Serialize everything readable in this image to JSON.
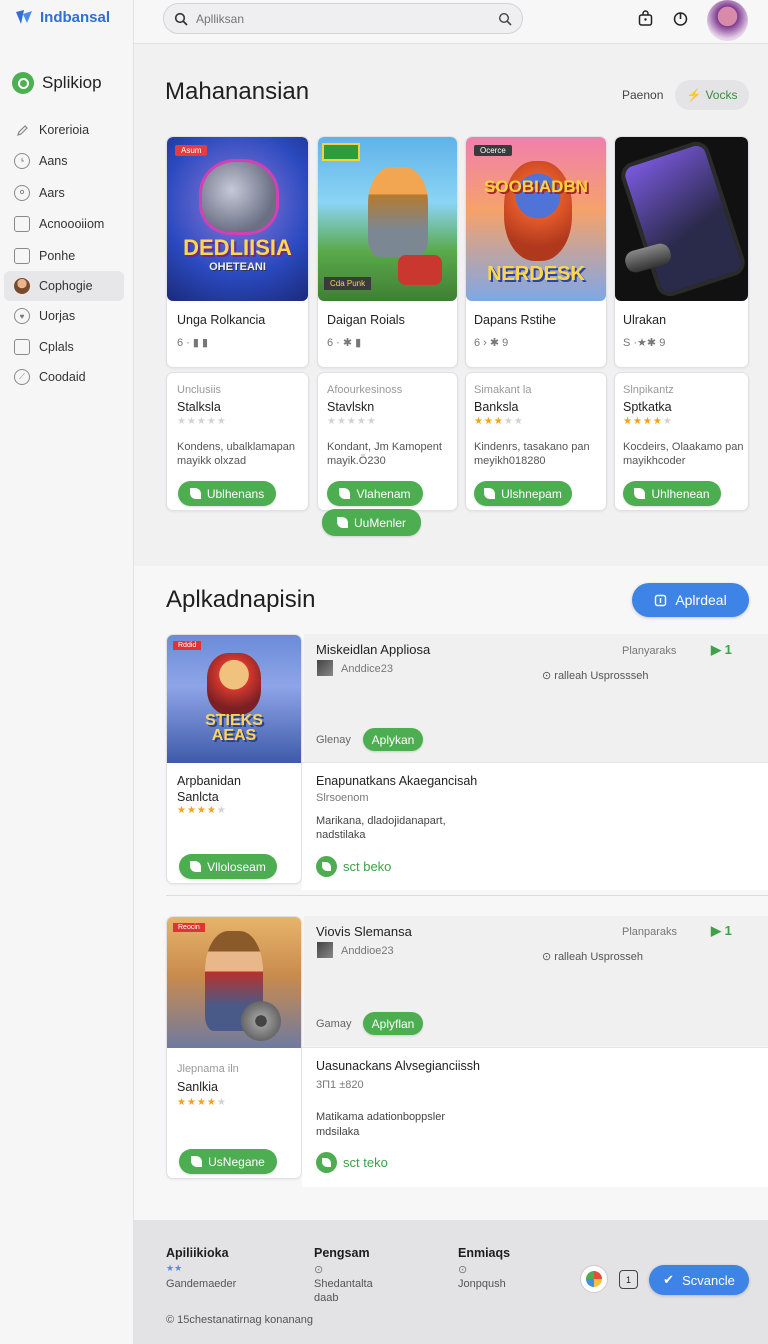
{
  "app": {
    "name": "Indbansal"
  },
  "sidebar": {
    "brand": "Splikiop",
    "items": [
      {
        "label": "Korerioia",
        "icon": "pencil-icon"
      },
      {
        "label": "Aans",
        "icon": "clock-icon"
      },
      {
        "label": "Aars",
        "icon": "user-icon"
      },
      {
        "label": "Acnoooiiom",
        "icon": "document-icon"
      },
      {
        "label": "Ponhe",
        "icon": "file-icon"
      },
      {
        "label": "Cophogie",
        "icon": "avatar-icon",
        "active": true
      },
      {
        "label": "Uorjas",
        "icon": "heart-icon"
      },
      {
        "label": "Cplals",
        "icon": "clipboard-icon"
      },
      {
        "label": "Coodaid",
        "icon": "compass-icon"
      }
    ]
  },
  "search": {
    "placeholder": "Aplliksan"
  },
  "featured": {
    "title": "Mahanansian",
    "filter_label": "Paenon",
    "filter_button": "Vocks",
    "top_cards": [
      {
        "name": "Unga Rolkancia",
        "meta": "6 · ▮ ▮",
        "badge": "Asum",
        "art": "DEDLIISIA",
        "art_sub": "OHETEANI"
      },
      {
        "name": "Daigan Roials",
        "meta": "6 · ✱ ▮",
        "badge": "",
        "art": "",
        "art_sub": "Cda Punk"
      },
      {
        "name": "Dapans Rstihe",
        "meta": "6 › ✱ 9",
        "badge": "Ocerce",
        "art": "SOOBIADBN",
        "art_sub": "NERDESK"
      },
      {
        "name": "Ulrakan",
        "meta": "S ·★✱ 9",
        "badge": "",
        "art": "",
        "art_sub": ""
      }
    ],
    "bottom_cards": [
      {
        "sub": "Unclusiis",
        "name": "Stalksla",
        "rating": 0,
        "desc1": "Kondens, ubalklamapan",
        "desc2": "mayikk olxzad",
        "button": "Ublhenans"
      },
      {
        "sub": "Afoourkesinoss",
        "name": "Stavlskn",
        "rating": 0,
        "desc1": "Kondant, Jm Kamopent",
        "desc2": "mayik.Ö230",
        "button": "Vlahenam"
      },
      {
        "sub": "Simakant la",
        "name": "Banksla",
        "rating": 3,
        "desc1": "Kindenrs, tasakano pan",
        "desc2": "meyikh018280",
        "button": "Ulshnepam"
      },
      {
        "sub": "Slnpikantz",
        "name": "Sptkatka",
        "rating": 4,
        "desc1": "Kocdeirs, Olaakamo pan",
        "desc2": "mayikhcoder",
        "button": "Uhlhenean"
      }
    ],
    "extra_button": "UuMenler"
  },
  "apps": {
    "title": "Aplkadnapisin",
    "action_button": "Aplrdeal",
    "entries": [
      {
        "badge": "Rddid",
        "art": "STIEKS AEAS",
        "title": "Miskeidlan Appliosa",
        "developer": "Anddice23",
        "category": "Planyaraks",
        "progress_text": "ralleah Usprossseh",
        "tag_label": "Glenay",
        "tag_button": "Aplykan",
        "left_name": "Arpbanidan",
        "left_sub": "Sanlcta",
        "rating": 4,
        "left_button": "Vlloloseam",
        "desc_title": "Enapunatkans Akaegancisah",
        "desc_sub": "Slrsoenom",
        "desc1": "Marikana, dladojidanapart,",
        "desc2": "nadstilaka",
        "link": "sct beko"
      },
      {
        "badge": "Reocin",
        "art": "",
        "title": "Viovis Slemansa",
        "developer": "Anddioe23",
        "category": "Planparaks",
        "progress_text": "ralleah Usprosseh",
        "tag_label": "Gamay",
        "tag_button": "Aplyflan",
        "left_name": "Sanlkia",
        "left_sub": "Jlepnama iln",
        "rating": 4,
        "left_button": "UsNegane",
        "desc_title": "Uasunackans Alvsegianciissh",
        "desc_sub": "3Π1 ±820",
        "desc1": "Matikama adationboppsler",
        "desc2": "mdsilaka",
        "link": "sct teko"
      }
    ]
  },
  "footer": {
    "columns": [
      {
        "title": "Apiliikioka",
        "line1": "Gandemaeder",
        "line2": ""
      },
      {
        "title": "Pengsam",
        "line1": "Shedantalta",
        "line2": "daab"
      },
      {
        "title": "Enmiaqs",
        "line1": "Jonpqush",
        "line2": ""
      }
    ],
    "copyright": "15chestanatirnag konanang",
    "button": "Scvancle"
  }
}
